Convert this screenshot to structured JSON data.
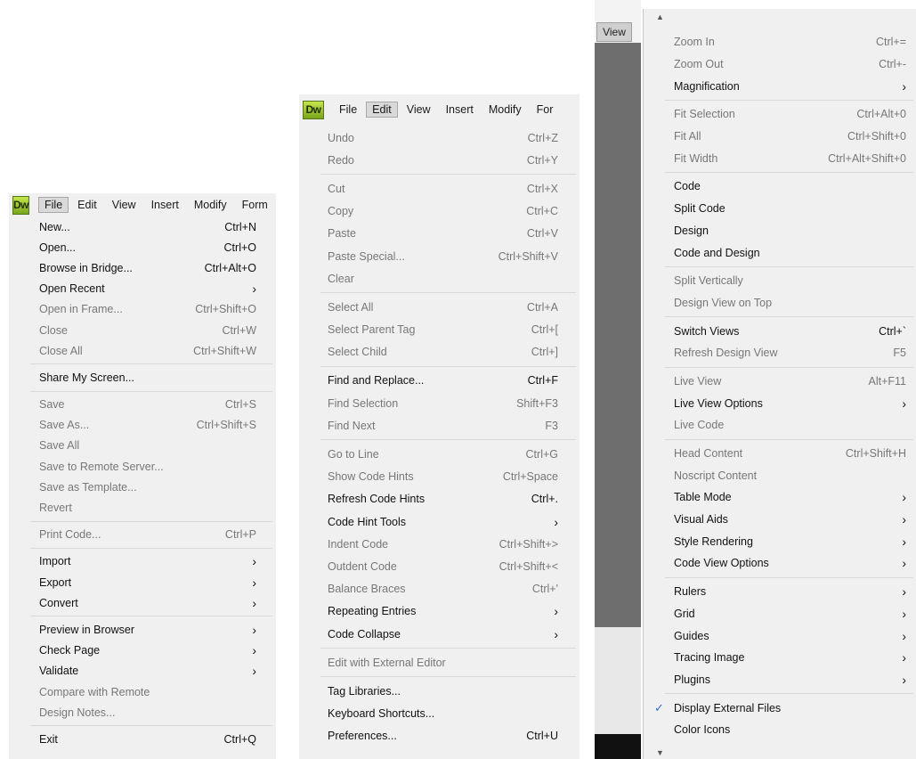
{
  "panel1": {
    "logo": "Dw",
    "menubar": [
      "File",
      "Edit",
      "View",
      "Insert",
      "Modify",
      "Form"
    ],
    "active": "File",
    "groups": [
      [
        {
          "label": "New...",
          "shortcut": "Ctrl+N",
          "enabled": true
        },
        {
          "label": "Open...",
          "shortcut": "Ctrl+O",
          "enabled": true
        },
        {
          "label": "Browse in Bridge...",
          "shortcut": "Ctrl+Alt+O",
          "enabled": true
        },
        {
          "label": "Open Recent",
          "shortcut": "",
          "submenu": true,
          "enabled": true
        },
        {
          "label": "Open in Frame...",
          "shortcut": "Ctrl+Shift+O",
          "enabled": false
        },
        {
          "label": "Close",
          "shortcut": "Ctrl+W",
          "enabled": false
        },
        {
          "label": "Close All",
          "shortcut": "Ctrl+Shift+W",
          "enabled": false
        }
      ],
      [
        {
          "label": "Share My Screen...",
          "shortcut": "",
          "enabled": true
        }
      ],
      [
        {
          "label": "Save",
          "shortcut": "Ctrl+S",
          "enabled": false
        },
        {
          "label": "Save As...",
          "shortcut": "Ctrl+Shift+S",
          "enabled": false
        },
        {
          "label": "Save All",
          "shortcut": "",
          "enabled": false
        },
        {
          "label": "Save to Remote Server...",
          "shortcut": "",
          "enabled": false
        },
        {
          "label": "Save as Template...",
          "shortcut": "",
          "enabled": false
        },
        {
          "label": "Revert",
          "shortcut": "",
          "enabled": false
        }
      ],
      [
        {
          "label": "Print Code...",
          "shortcut": "Ctrl+P",
          "enabled": false
        }
      ],
      [
        {
          "label": "Import",
          "shortcut": "",
          "submenu": true,
          "enabled": true
        },
        {
          "label": "Export",
          "shortcut": "",
          "submenu": true,
          "enabled": true
        },
        {
          "label": "Convert",
          "shortcut": "",
          "submenu": true,
          "enabled": true
        }
      ],
      [
        {
          "label": "Preview in Browser",
          "shortcut": "",
          "submenu": true,
          "enabled": true
        },
        {
          "label": "Check Page",
          "shortcut": "",
          "submenu": true,
          "enabled": true
        },
        {
          "label": "Validate",
          "shortcut": "",
          "submenu": true,
          "enabled": true
        },
        {
          "label": "Compare with Remote",
          "shortcut": "",
          "enabled": false
        },
        {
          "label": "Design Notes...",
          "shortcut": "",
          "enabled": false
        }
      ],
      [
        {
          "label": "Exit",
          "shortcut": "Ctrl+Q",
          "enabled": true
        }
      ]
    ]
  },
  "panel2": {
    "logo": "Dw",
    "menubar": [
      "File",
      "Edit",
      "View",
      "Insert",
      "Modify",
      "For"
    ],
    "active": "Edit",
    "groups": [
      [
        {
          "label": "Undo",
          "shortcut": "Ctrl+Z",
          "enabled": false
        },
        {
          "label": "Redo",
          "shortcut": "Ctrl+Y",
          "enabled": false
        }
      ],
      [
        {
          "label": "Cut",
          "shortcut": "Ctrl+X",
          "enabled": false
        },
        {
          "label": "Copy",
          "shortcut": "Ctrl+C",
          "enabled": false
        },
        {
          "label": "Paste",
          "shortcut": "Ctrl+V",
          "enabled": false
        },
        {
          "label": "Paste Special...",
          "shortcut": "Ctrl+Shift+V",
          "enabled": false
        },
        {
          "label": "Clear",
          "shortcut": "",
          "enabled": false
        }
      ],
      [
        {
          "label": "Select All",
          "shortcut": "Ctrl+A",
          "enabled": false
        },
        {
          "label": "Select Parent Tag",
          "shortcut": "Ctrl+[",
          "enabled": false
        },
        {
          "label": "Select Child",
          "shortcut": "Ctrl+]",
          "enabled": false
        }
      ],
      [
        {
          "label": "Find and Replace...",
          "shortcut": "Ctrl+F",
          "enabled": true
        },
        {
          "label": "Find Selection",
          "shortcut": "Shift+F3",
          "enabled": false
        },
        {
          "label": "Find Next",
          "shortcut": "F3",
          "enabled": false
        }
      ],
      [
        {
          "label": "Go to Line",
          "shortcut": "Ctrl+G",
          "enabled": false
        },
        {
          "label": "Show Code Hints",
          "shortcut": "Ctrl+Space",
          "enabled": false
        },
        {
          "label": "Refresh Code Hints",
          "shortcut": "Ctrl+.",
          "enabled": true
        },
        {
          "label": "Code Hint Tools",
          "shortcut": "",
          "submenu": true,
          "enabled": true
        },
        {
          "label": "Indent Code",
          "shortcut": "Ctrl+Shift+>",
          "enabled": false
        },
        {
          "label": "Outdent Code",
          "shortcut": "Ctrl+Shift+<",
          "enabled": false
        },
        {
          "label": "Balance Braces",
          "shortcut": "Ctrl+'",
          "enabled": false
        },
        {
          "label": "Repeating Entries",
          "shortcut": "",
          "submenu": true,
          "enabled": true
        },
        {
          "label": "Code Collapse",
          "shortcut": "",
          "submenu": true,
          "enabled": true
        }
      ],
      [
        {
          "label": "Edit with External Editor",
          "shortcut": "",
          "enabled": false
        }
      ],
      [
        {
          "label": "Tag Libraries...",
          "shortcut": "",
          "enabled": true
        },
        {
          "label": "Keyboard Shortcuts...",
          "shortcut": "",
          "enabled": true
        },
        {
          "label": "Preferences...",
          "shortcut": "Ctrl+U",
          "enabled": true
        }
      ]
    ]
  },
  "panel3": {
    "view_tab": "View",
    "scroll_up": "▲",
    "scroll_down": "▼",
    "check_mark": "✓",
    "groups": [
      [
        {
          "label": "Zoom In",
          "shortcut": "Ctrl+=",
          "enabled": false
        },
        {
          "label": "Zoom Out",
          "shortcut": "Ctrl+-",
          "enabled": false
        },
        {
          "label": "Magnification",
          "shortcut": "",
          "submenu": true,
          "enabled": true
        }
      ],
      [
        {
          "label": "Fit Selection",
          "shortcut": "Ctrl+Alt+0",
          "enabled": false
        },
        {
          "label": "Fit All",
          "shortcut": "Ctrl+Shift+0",
          "enabled": false
        },
        {
          "label": "Fit Width",
          "shortcut": "Ctrl+Alt+Shift+0",
          "enabled": false
        }
      ],
      [
        {
          "label": "Code",
          "shortcut": "",
          "enabled": true
        },
        {
          "label": "Split Code",
          "shortcut": "",
          "enabled": true
        },
        {
          "label": "Design",
          "shortcut": "",
          "enabled": true
        },
        {
          "label": "Code and Design",
          "shortcut": "",
          "enabled": true
        }
      ],
      [
        {
          "label": "Split Vertically",
          "shortcut": "",
          "enabled": false
        },
        {
          "label": "Design View on Top",
          "shortcut": "",
          "enabled": false
        }
      ],
      [
        {
          "label": "Switch Views",
          "shortcut": "Ctrl+`",
          "enabled": true
        },
        {
          "label": "Refresh Design View",
          "shortcut": "F5",
          "enabled": false
        }
      ],
      [
        {
          "label": "Live View",
          "shortcut": "Alt+F11",
          "enabled": false
        },
        {
          "label": "Live View Options",
          "shortcut": "",
          "submenu": true,
          "enabled": true
        },
        {
          "label": "Live Code",
          "shortcut": "",
          "enabled": false
        }
      ],
      [
        {
          "label": "Head Content",
          "shortcut": "Ctrl+Shift+H",
          "enabled": false
        },
        {
          "label": "Noscript Content",
          "shortcut": "",
          "enabled": false
        },
        {
          "label": "Table Mode",
          "shortcut": "",
          "submenu": true,
          "enabled": true
        },
        {
          "label": "Visual Aids",
          "shortcut": "",
          "submenu": true,
          "enabled": true
        },
        {
          "label": "Style Rendering",
          "shortcut": "",
          "submenu": true,
          "enabled": true
        },
        {
          "label": "Code View Options",
          "shortcut": "",
          "submenu": true,
          "enabled": true
        }
      ],
      [
        {
          "label": "Rulers",
          "shortcut": "",
          "submenu": true,
          "enabled": true
        },
        {
          "label": "Grid",
          "shortcut": "",
          "submenu": true,
          "enabled": true
        },
        {
          "label": "Guides",
          "shortcut": "",
          "submenu": true,
          "enabled": true
        },
        {
          "label": "Tracing Image",
          "shortcut": "",
          "submenu": true,
          "enabled": true
        },
        {
          "label": "Plugins",
          "shortcut": "",
          "submenu": true,
          "enabled": true
        }
      ],
      [
        {
          "label": "Display External Files",
          "shortcut": "",
          "checked": true,
          "enabled": true
        },
        {
          "label": "Color Icons",
          "shortcut": "",
          "enabled": true
        }
      ]
    ]
  }
}
